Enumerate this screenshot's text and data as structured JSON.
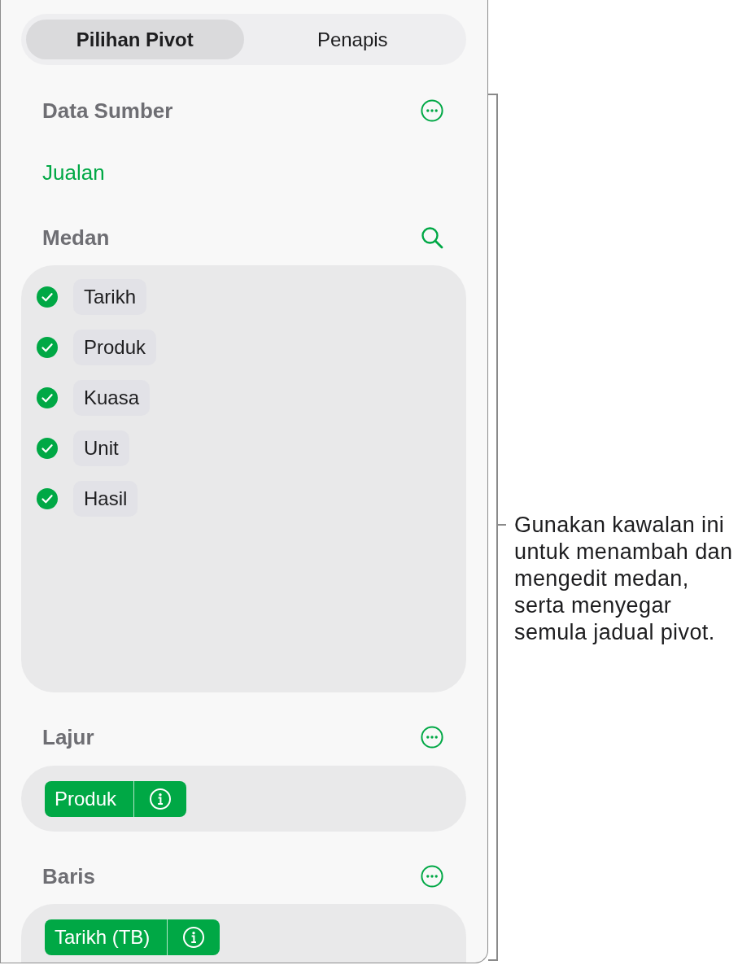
{
  "tabs": [
    {
      "label": "Pilihan Pivot",
      "selected": true
    },
    {
      "label": "Penapis",
      "selected": false
    }
  ],
  "source_data": {
    "title": "Data Sumber",
    "table": "Jualan"
  },
  "fields": {
    "title": "Medan",
    "items": [
      {
        "label": "Tarikh",
        "checked": true
      },
      {
        "label": "Produk",
        "checked": true
      },
      {
        "label": "Kuasa",
        "checked": true
      },
      {
        "label": "Unit",
        "checked": true
      },
      {
        "label": "Hasil",
        "checked": true
      }
    ]
  },
  "columns": {
    "title": "Lajur",
    "fields": [
      {
        "label": "Produk"
      }
    ]
  },
  "rows": {
    "title": "Baris",
    "fields": [
      {
        "label": "Tarikh (TB)"
      }
    ]
  },
  "callout": {
    "lines": [
      "Gunakan kawalan ini",
      "untuk menambah dan",
      "mengedit medan,",
      "serta menyegar",
      "semula jadual pivot."
    ]
  }
}
